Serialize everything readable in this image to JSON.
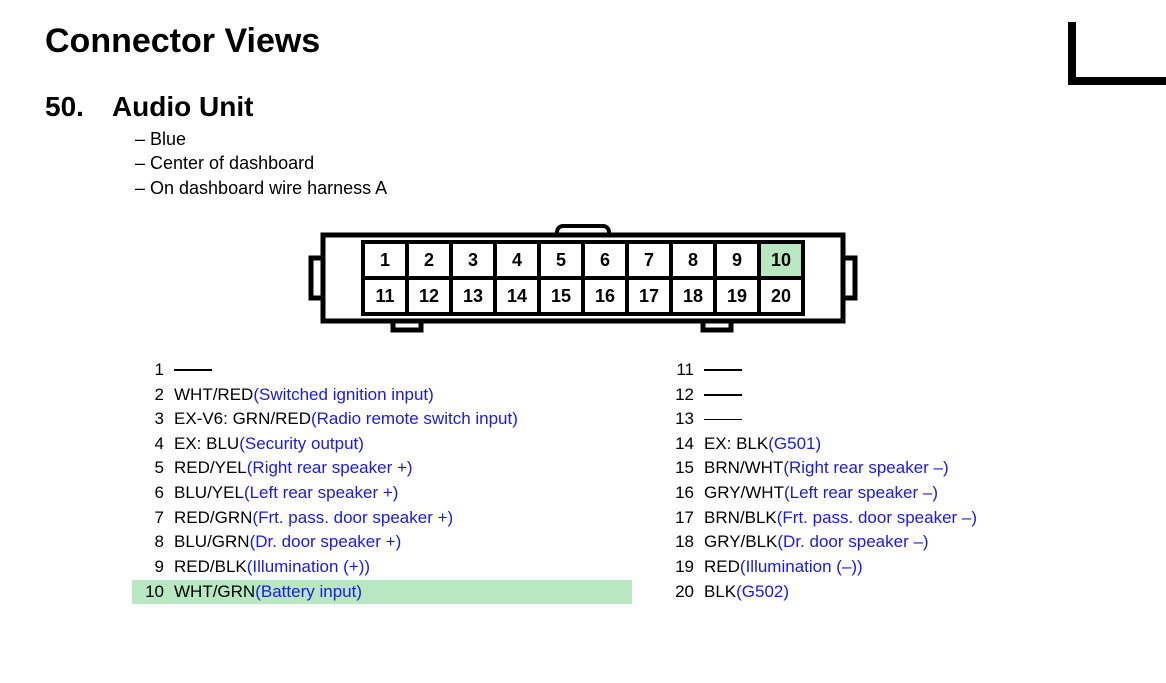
{
  "page_title": "Connector Views",
  "section": {
    "number": "50.",
    "title": "Audio Unit",
    "notes": [
      "– Blue",
      "– Center of dashboard",
      "– On dashboard wire harness A"
    ]
  },
  "connector": {
    "pins": [
      1,
      2,
      3,
      4,
      5,
      6,
      7,
      8,
      9,
      10,
      11,
      12,
      13,
      14,
      15,
      16,
      17,
      18,
      19,
      20
    ],
    "highlighted_pin": 10
  },
  "pin_list_left": [
    {
      "num": "1",
      "wire": "",
      "desc": "",
      "dash": true
    },
    {
      "num": "2",
      "wire": "WHT/RED ",
      "desc": "(Switched ignition input)"
    },
    {
      "num": "3",
      "wire": "EX-V6: GRN/RED ",
      "desc": "(Radio remote switch input)"
    },
    {
      "num": "4",
      "wire": "EX: BLU ",
      "desc": "(Security output)"
    },
    {
      "num": "5",
      "wire": "RED/YEL ",
      "desc": "(Right rear speaker +)"
    },
    {
      "num": "6",
      "wire": "BLU/YEL ",
      "desc": "(Left rear speaker +)"
    },
    {
      "num": "7",
      "wire": "RED/GRN ",
      "desc": "(Frt. pass. door speaker +)"
    },
    {
      "num": "8",
      "wire": "BLU/GRN ",
      "desc": "(Dr. door speaker +)"
    },
    {
      "num": "9",
      "wire": "RED/BLK ",
      "desc": "(Illumination (+))"
    },
    {
      "num": "10",
      "wire": "WHT/GRN ",
      "desc": "(Battery input)",
      "highlight": true
    }
  ],
  "pin_list_right": [
    {
      "num": "11",
      "wire": "",
      "desc": "",
      "dash": true
    },
    {
      "num": "12",
      "wire": "",
      "desc": "",
      "dash": true
    },
    {
      "num": "13",
      "wire": "",
      "desc": "",
      "dash": true
    },
    {
      "num": "14",
      "wire": "EX: BLK ",
      "desc": "(G501)"
    },
    {
      "num": "15",
      "wire": "BRN/WHT ",
      "desc": "(Right rear speaker –)"
    },
    {
      "num": "16",
      "wire": "GRY/WHT ",
      "desc": "(Left rear speaker –)"
    },
    {
      "num": "17",
      "wire": "BRN/BLK ",
      "desc": "(Frt. pass. door speaker –)"
    },
    {
      "num": "18",
      "wire": "GRY/BLK ",
      "desc": "(Dr. door speaker –)"
    },
    {
      "num": "19",
      "wire": "RED ",
      "desc": "(Illumination (–))"
    },
    {
      "num": "20",
      "wire": "BLK ",
      "desc": "(G502)"
    }
  ]
}
